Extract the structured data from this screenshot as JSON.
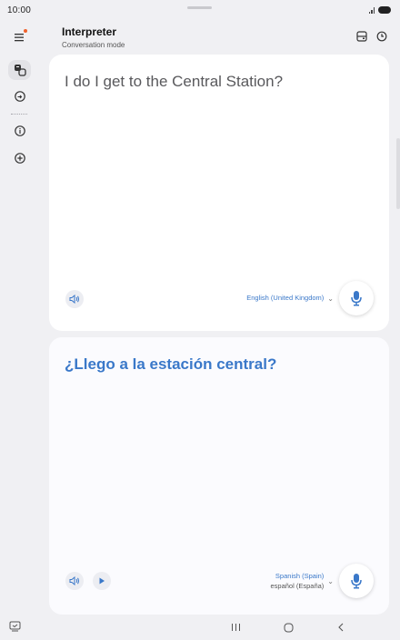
{
  "status_bar": {
    "time": "10:00"
  },
  "header": {
    "title": "Interpreter",
    "subtitle": "Conversation mode"
  },
  "rail": {
    "items": [
      {
        "icon": "translate-icon",
        "active": true
      },
      {
        "icon": "chat-translate-icon",
        "active": false
      },
      {
        "icon": "info-icon",
        "active": false
      },
      {
        "icon": "add-icon",
        "active": false
      }
    ]
  },
  "source_panel": {
    "text": "I do I get to the Central Station?",
    "language": "English (United Kingdom)"
  },
  "target_panel": {
    "text": "¿Llego a la estación central?",
    "language": "Spanish (Spain)",
    "language_native": "español (España)"
  },
  "colors": {
    "accent": "#3a78c9",
    "background": "#f0f0f3",
    "card": "#ffffff",
    "notification_dot": "#f0622c"
  }
}
